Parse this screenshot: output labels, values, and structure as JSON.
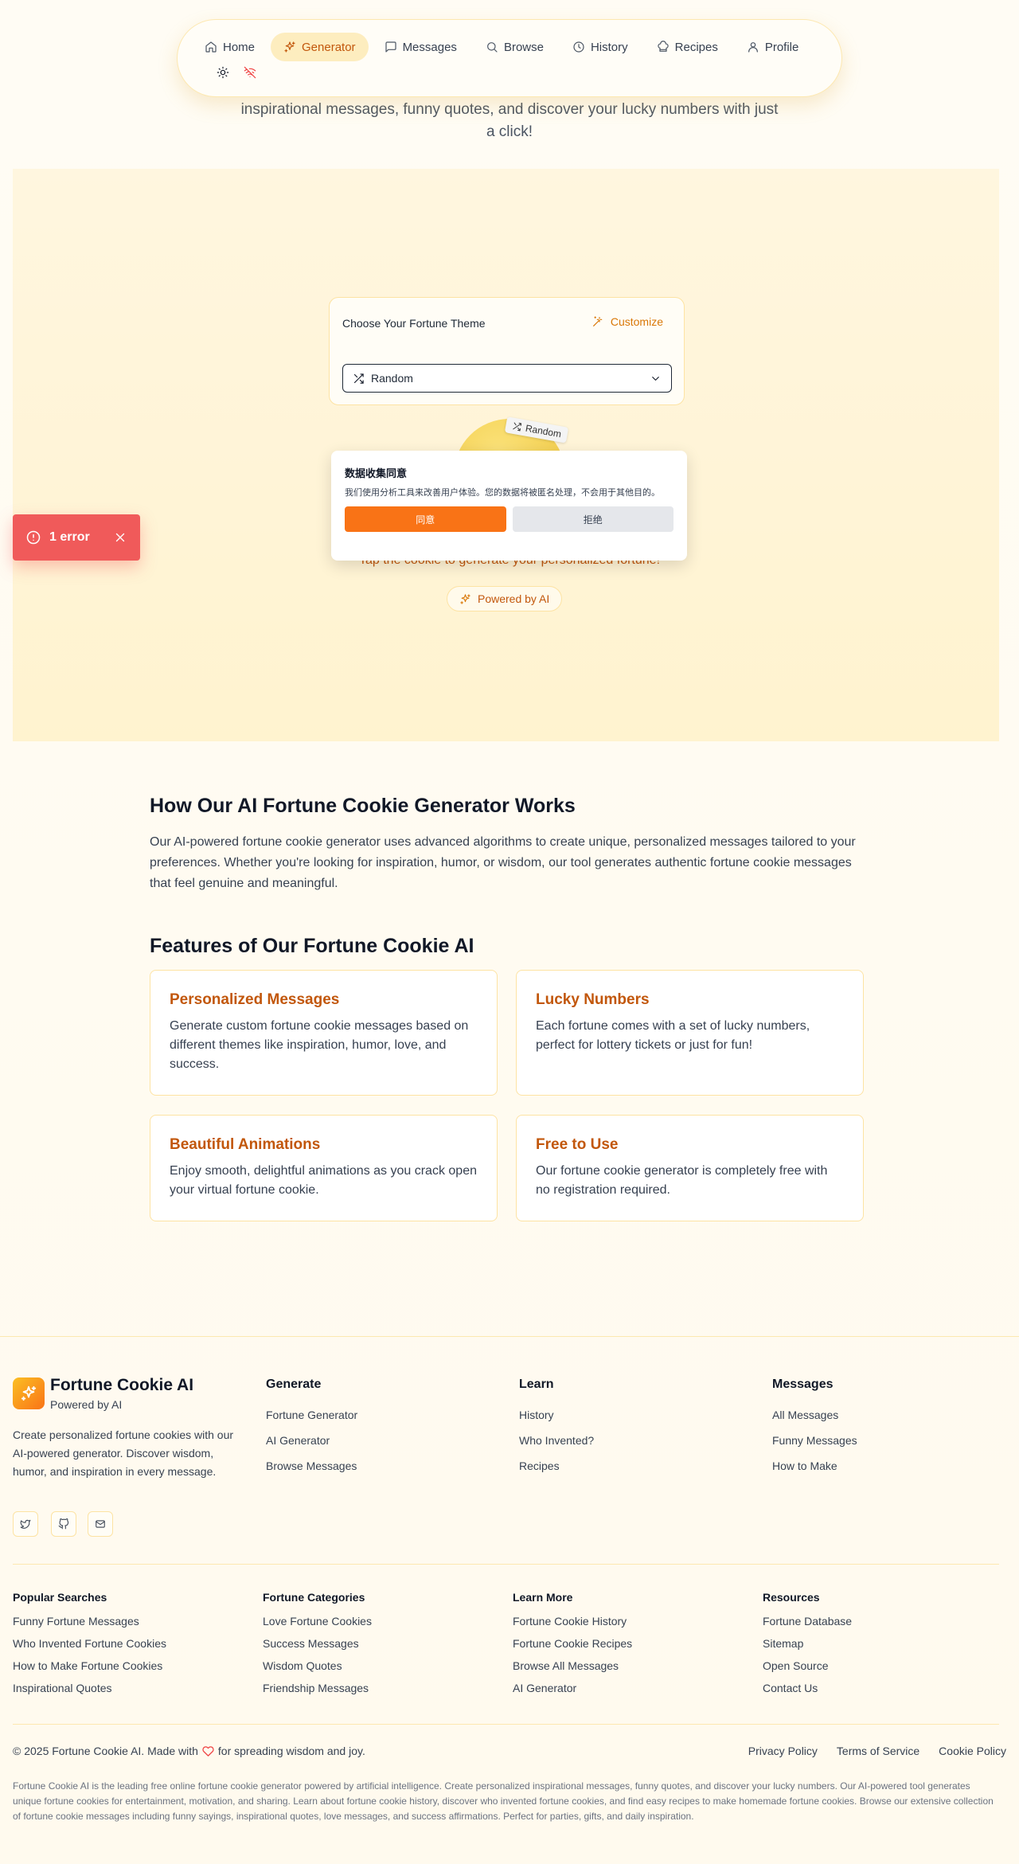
{
  "nav": {
    "items": [
      {
        "label": "Home",
        "icon": "home-icon"
      },
      {
        "label": "Generator",
        "icon": "sparkles-icon",
        "active": true
      },
      {
        "label": "Messages",
        "icon": "message-icon"
      },
      {
        "label": "Browse",
        "icon": "search-icon"
      },
      {
        "label": "History",
        "icon": "clock-icon"
      },
      {
        "label": "Recipes",
        "icon": "chef-hat-icon"
      },
      {
        "label": "Profile",
        "icon": "user-icon"
      }
    ],
    "tools": [
      "sun-icon",
      "wifi-off-icon"
    ]
  },
  "hero": {
    "subtitle": "inspirational messages, funny quotes, and discover your lucky numbers with just a click!"
  },
  "generator": {
    "theme_title": "Choose Your Fortune Theme",
    "customize_label": "Customize",
    "selected_theme": "Random",
    "cookie_tag": "Random",
    "tap_text": "Tap the cookie to generate your personalized fortune!",
    "powered_label": "Powered by AI"
  },
  "consent": {
    "title": "数据收集同意",
    "body": "我们使用分析工具来改善用户体验。您的数据将被匿名处理，不会用于其他目的。",
    "agree_label": "同意",
    "decline_label": "拒绝"
  },
  "error_toast": {
    "label": "1 error"
  },
  "how": {
    "title": "How Our AI Fortune Cookie Generator Works",
    "text": "Our AI-powered fortune cookie generator uses advanced algorithms to create unique, personalized messages tailored to your preferences. Whether you're looking for inspiration, humor, or wisdom, our tool generates authentic fortune cookie messages that feel genuine and meaningful."
  },
  "features": {
    "title": "Features of Our Fortune Cookie AI",
    "items": [
      {
        "title": "Personalized Messages",
        "text": "Generate custom fortune cookie messages based on different themes like inspiration, humor, love, and success."
      },
      {
        "title": "Lucky Numbers",
        "text": "Each fortune comes with a set of lucky numbers, perfect for lottery tickets or just for fun!"
      },
      {
        "title": "Beautiful Animations",
        "text": "Enjoy smooth, delightful animations as you crack open your virtual fortune cookie."
      },
      {
        "title": "Free to Use",
        "text": "Our fortune cookie generator is completely free with no registration required."
      }
    ]
  },
  "footer": {
    "brand": "Fortune Cookie AI",
    "brand_sub": "Powered by AI",
    "description": "Create personalized fortune cookies with our AI-powered generator. Discover wisdom, humor, and inspiration in every message.",
    "socials": [
      "twitter-icon",
      "github-icon",
      "mail-icon"
    ],
    "columns": [
      {
        "title": "Generate",
        "links": [
          "Fortune Generator",
          "AI Generator",
          "Browse Messages"
        ]
      },
      {
        "title": "Learn",
        "links": [
          "History",
          "Who Invented?",
          "Recipes"
        ]
      },
      {
        "title": "Messages",
        "links": [
          "All Messages",
          "Funny Messages",
          "How to Make"
        ]
      }
    ],
    "seo_columns": [
      {
        "title": "Popular Searches",
        "links": [
          "Funny Fortune Messages",
          "Who Invented Fortune Cookies",
          "How to Make Fortune Cookies",
          "Inspirational Quotes"
        ]
      },
      {
        "title": "Fortune Categories",
        "links": [
          "Love Fortune Cookies",
          "Success Messages",
          "Wisdom Quotes",
          "Friendship Messages"
        ]
      },
      {
        "title": "Learn More",
        "links": [
          "Fortune Cookie History",
          "Fortune Cookie Recipes",
          "Browse All Messages",
          "AI Generator"
        ]
      },
      {
        "title": "Resources",
        "links": [
          "Fortune Database",
          "Sitemap",
          "Open Source",
          "Contact Us"
        ]
      }
    ],
    "copyright_pre": "© 2025 Fortune Cookie AI. Made with",
    "copyright_post": "for spreading wisdom and joy.",
    "legal": [
      "Privacy Policy",
      "Terms of Service",
      "Cookie Policy"
    ],
    "seo_text": "Fortune Cookie AI is the leading free online fortune cookie generator powered by artificial intelligence. Create personalized inspirational messages, funny quotes, and discover your lucky numbers. Our AI-powered tool generates unique fortune cookies for entertainment, motivation, and sharing. Learn about fortune cookie history, discover who invented fortune cookies, and find easy recipes to make homemade fortune cookies. Browse our extensive collection of fortune cookie messages including funny sayings, inspirational quotes, love messages, and success affirmations. Perfect for parties, gifts, and daily inspiration."
  },
  "colors": {
    "accent": "#c2570c",
    "accent_bg": "#fdedbf",
    "agree_button": "#f97316",
    "error_toast": "#f05a5a"
  }
}
